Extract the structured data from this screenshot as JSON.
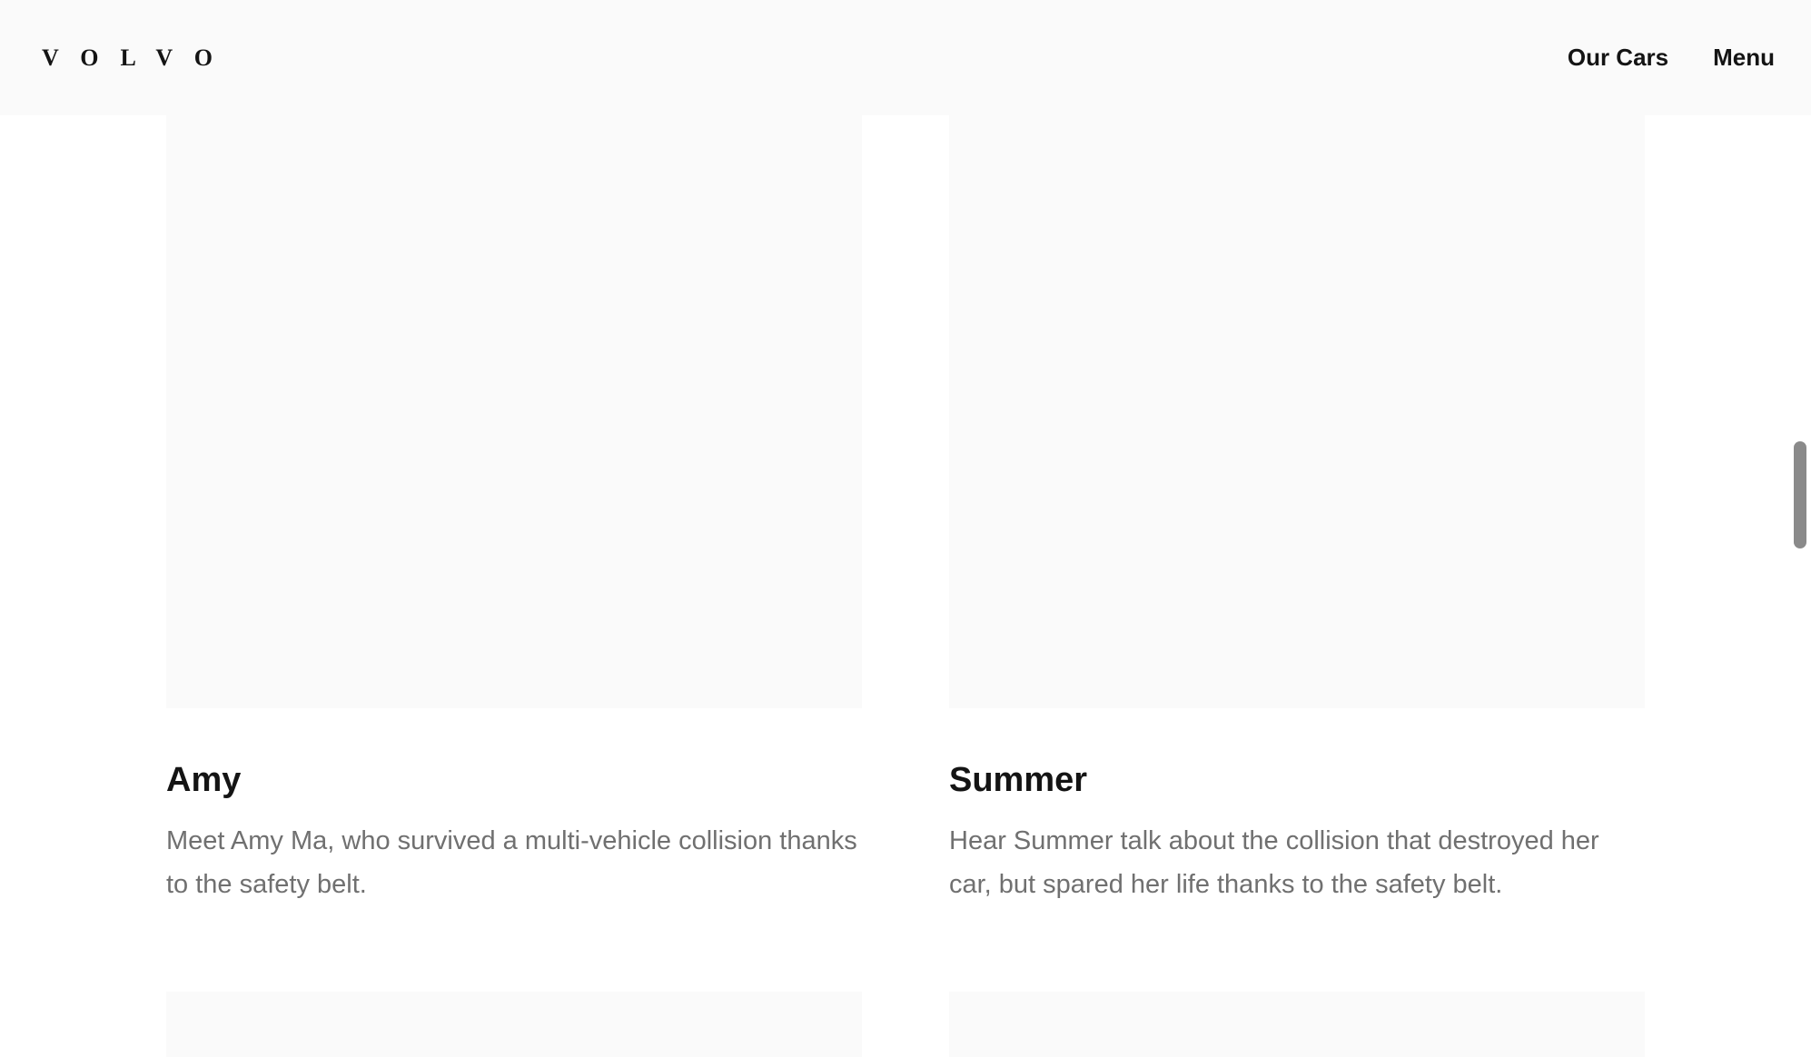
{
  "header": {
    "logo_text": "VOLVO",
    "nav": {
      "our_cars_label": "Our Cars",
      "menu_label": "Menu"
    }
  },
  "stories": [
    {
      "title": "Amy",
      "description": "Meet Amy Ma, who survived a multi-vehicle collision thanks to the safety belt."
    },
    {
      "title": "Summer",
      "description": "Hear Summer talk about the collision that destroyed her car, but spared her life thanks to the safety belt."
    }
  ],
  "colors": {
    "text_primary": "#141414",
    "text_secondary": "#707070",
    "surface": "#fafafa"
  }
}
